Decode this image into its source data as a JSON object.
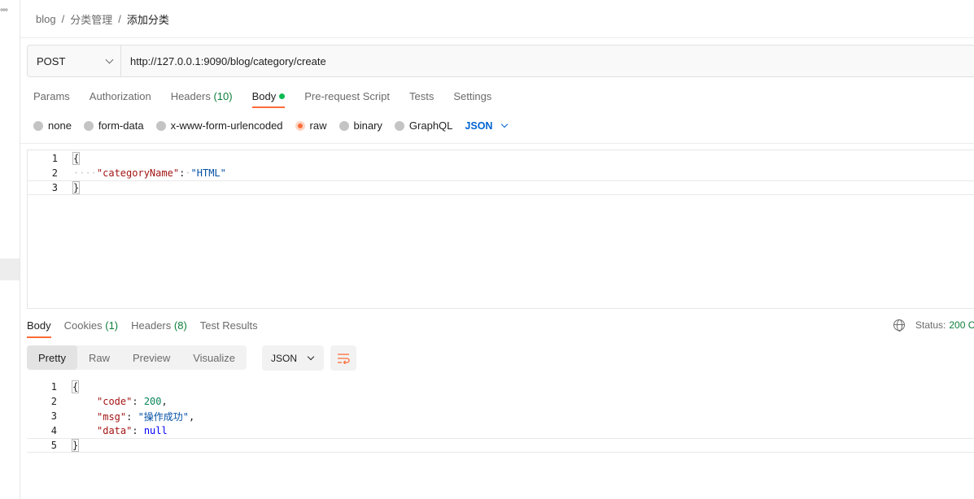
{
  "sidebar": {
    "more_glyph": "°°°"
  },
  "breadcrumb": [
    {
      "label": "blog"
    },
    {
      "label": "分类管理"
    },
    {
      "label": "添加分类"
    }
  ],
  "breadcrumb_separator": "/",
  "request": {
    "method": "POST",
    "url": "http://127.0.0.1:9090/blog/category/create"
  },
  "request_tabs": {
    "params": "Params",
    "authorization": "Authorization",
    "headers": "Headers",
    "headers_count": "(10)",
    "body": "Body",
    "pre_request": "Pre-request Script",
    "tests": "Tests",
    "settings": "Settings"
  },
  "body_types": {
    "none": "none",
    "form_data": "form-data",
    "urlencoded": "x-www-form-urlencoded",
    "raw": "raw",
    "binary": "binary",
    "graphql": "GraphQL",
    "format": "JSON"
  },
  "request_body": {
    "line_numbers": [
      "1",
      "2",
      "3"
    ],
    "open_brace": "{",
    "indent": "····",
    "key": "\"categoryName\"",
    "colon": ":",
    "colon_ws": "·",
    "value": "\"HTML\"",
    "close_brace": "}"
  },
  "response_tabs": {
    "body": "Body",
    "cookies": "Cookies",
    "cookies_count": "(1)",
    "headers": "Headers",
    "headers_count": "(8)",
    "test_results": "Test Results"
  },
  "status": {
    "label": "Status:",
    "value": "200 C"
  },
  "view_modes": {
    "pretty": "Pretty",
    "raw": "Raw",
    "preview": "Preview",
    "visualize": "Visualize"
  },
  "response_format": "JSON",
  "response_body": {
    "line_numbers": [
      "1",
      "2",
      "3",
      "4",
      "5"
    ],
    "open_brace": "{",
    "code_key": "\"code\"",
    "code_value": "200",
    "msg_key": "\"msg\"",
    "msg_value": "\"操作成功\"",
    "data_key": "\"data\"",
    "data_value": "null",
    "colon": ": ",
    "comma": ",",
    "close_brace": "}"
  },
  "colors": {
    "accent": "#ff6c37",
    "success": "#0cbb52",
    "link": "#0265d2"
  }
}
